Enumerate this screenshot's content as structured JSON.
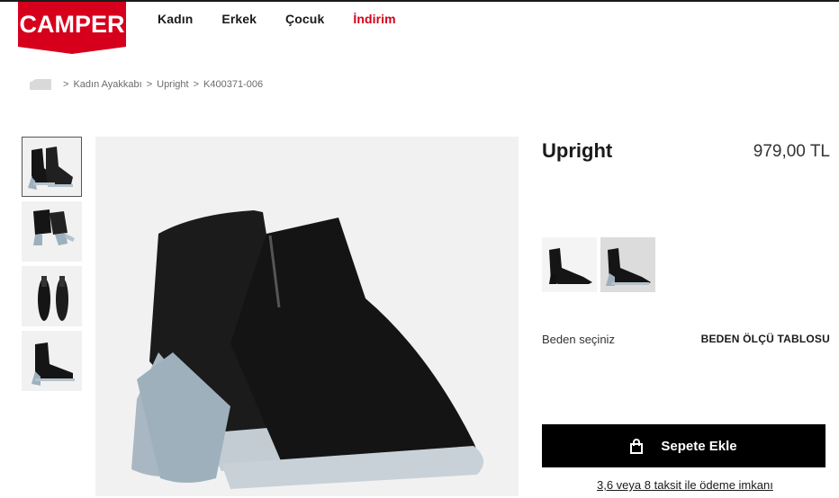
{
  "brand": {
    "logo_text": "CAMPER",
    "logo_color": "#d6001c"
  },
  "nav": {
    "items": [
      {
        "label": "Kadın"
      },
      {
        "label": "Erkek"
      },
      {
        "label": "Çocuk"
      },
      {
        "label": "İndirim"
      }
    ],
    "sale_color": "#d6001c"
  },
  "breadcrumb": {
    "home_icon": "home-icon",
    "items": [
      "Kadın Ayakkabı",
      "Upright",
      "K400371-006"
    ],
    "separator": ">"
  },
  "gallery": {
    "thumbnail_count": 4,
    "active_index": 0
  },
  "product": {
    "name": "Upright",
    "price": "979,00 TL",
    "color_options": 2,
    "selected_color_index": 1,
    "size_prompt": "Beden seçiniz",
    "size_guide_label": "BEDEN ÖLÇÜ TABLOSU",
    "add_to_cart_label": "Sepete Ekle",
    "add_to_cart_icon": "shopping-bag-icon",
    "installment_text": "3,6 veya 8 taksit ile ödeme imkanı"
  }
}
